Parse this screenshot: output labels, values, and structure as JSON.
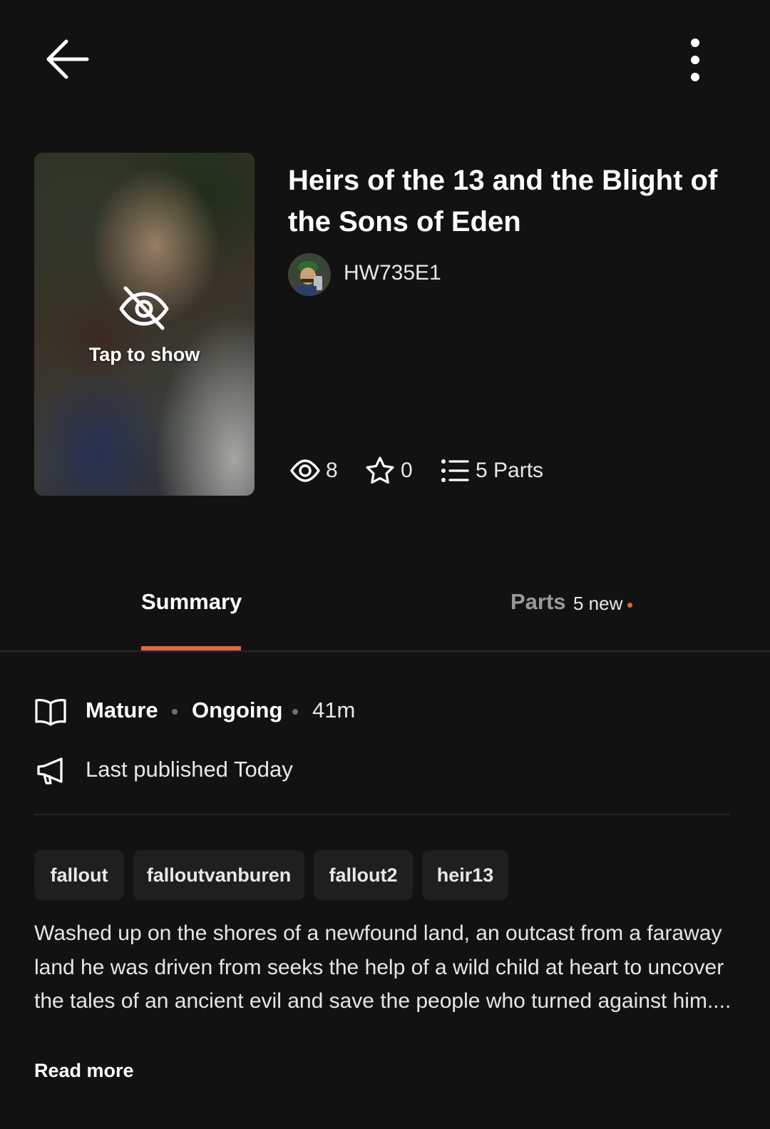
{
  "header": {
    "back_icon": "arrow-left-icon",
    "menu_icon": "more-vertical-icon"
  },
  "cover": {
    "hidden_icon": "eye-off-icon",
    "tap_label": "Tap to show"
  },
  "story": {
    "title": "Heirs of the 13 and the Blight of the Sons of Eden",
    "author": "HW735E1"
  },
  "stats": {
    "reads": "8",
    "votes": "0",
    "parts": "5 Parts",
    "icons": [
      "eye-icon",
      "star-icon",
      "list-icon"
    ]
  },
  "tabs": {
    "summary": "Summary",
    "parts": "Parts",
    "parts_new": "5 new",
    "active": "summary",
    "accent": "#e0673f"
  },
  "meta": {
    "book_icon": "book-icon",
    "rating": "Mature",
    "status": "Ongoing",
    "reading_time": "41m",
    "megaphone_icon": "megaphone-icon",
    "published": "Last published Today"
  },
  "tags": [
    "fallout",
    "falloutvanburen",
    "fallout2",
    "heir13"
  ],
  "description": {
    "text": "Washed up on the shores of a newfound land, an outcast from a faraway land he was driven from seeks the help of a wild child at heart to uncover the tales of an ancient evil and save the people who turned against him....",
    "read_more": "Read more"
  }
}
